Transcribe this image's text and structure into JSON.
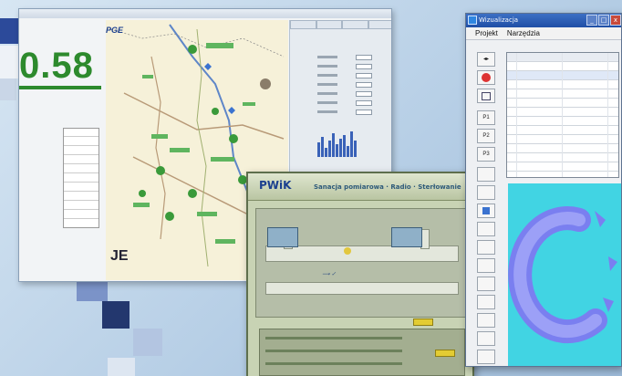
{
  "map_window": {
    "title": "",
    "big_reading": "0.58",
    "brand_logo": "PGE",
    "footer_logo": "JE"
  },
  "pwik_window": {
    "logo": "PWiK",
    "title": "Sanacja pomiarowa · Radio · Sterłowanie"
  },
  "right_window": {
    "title": "Wizualizacja",
    "menu": [
      "Projekt",
      "Narzędzia"
    ],
    "caption_buttons": [
      "_",
      "□",
      "x"
    ],
    "toolbar_labels": [
      "P1",
      "P2",
      "P3"
    ]
  },
  "colors": {
    "background": "#b7cfe6",
    "reading_green": "#2d8a2d",
    "map_bg": "#f6f1d9",
    "pwik_bg": "#c8d3b4",
    "right_title_bar": "#1f4fa6",
    "cyan_panel": "#41d4e3",
    "logo_ring": "#7a7ff0"
  },
  "icons": [
    "window-app-icon",
    "stop-icon",
    "calendar-icon",
    "map-marker-icon"
  ]
}
